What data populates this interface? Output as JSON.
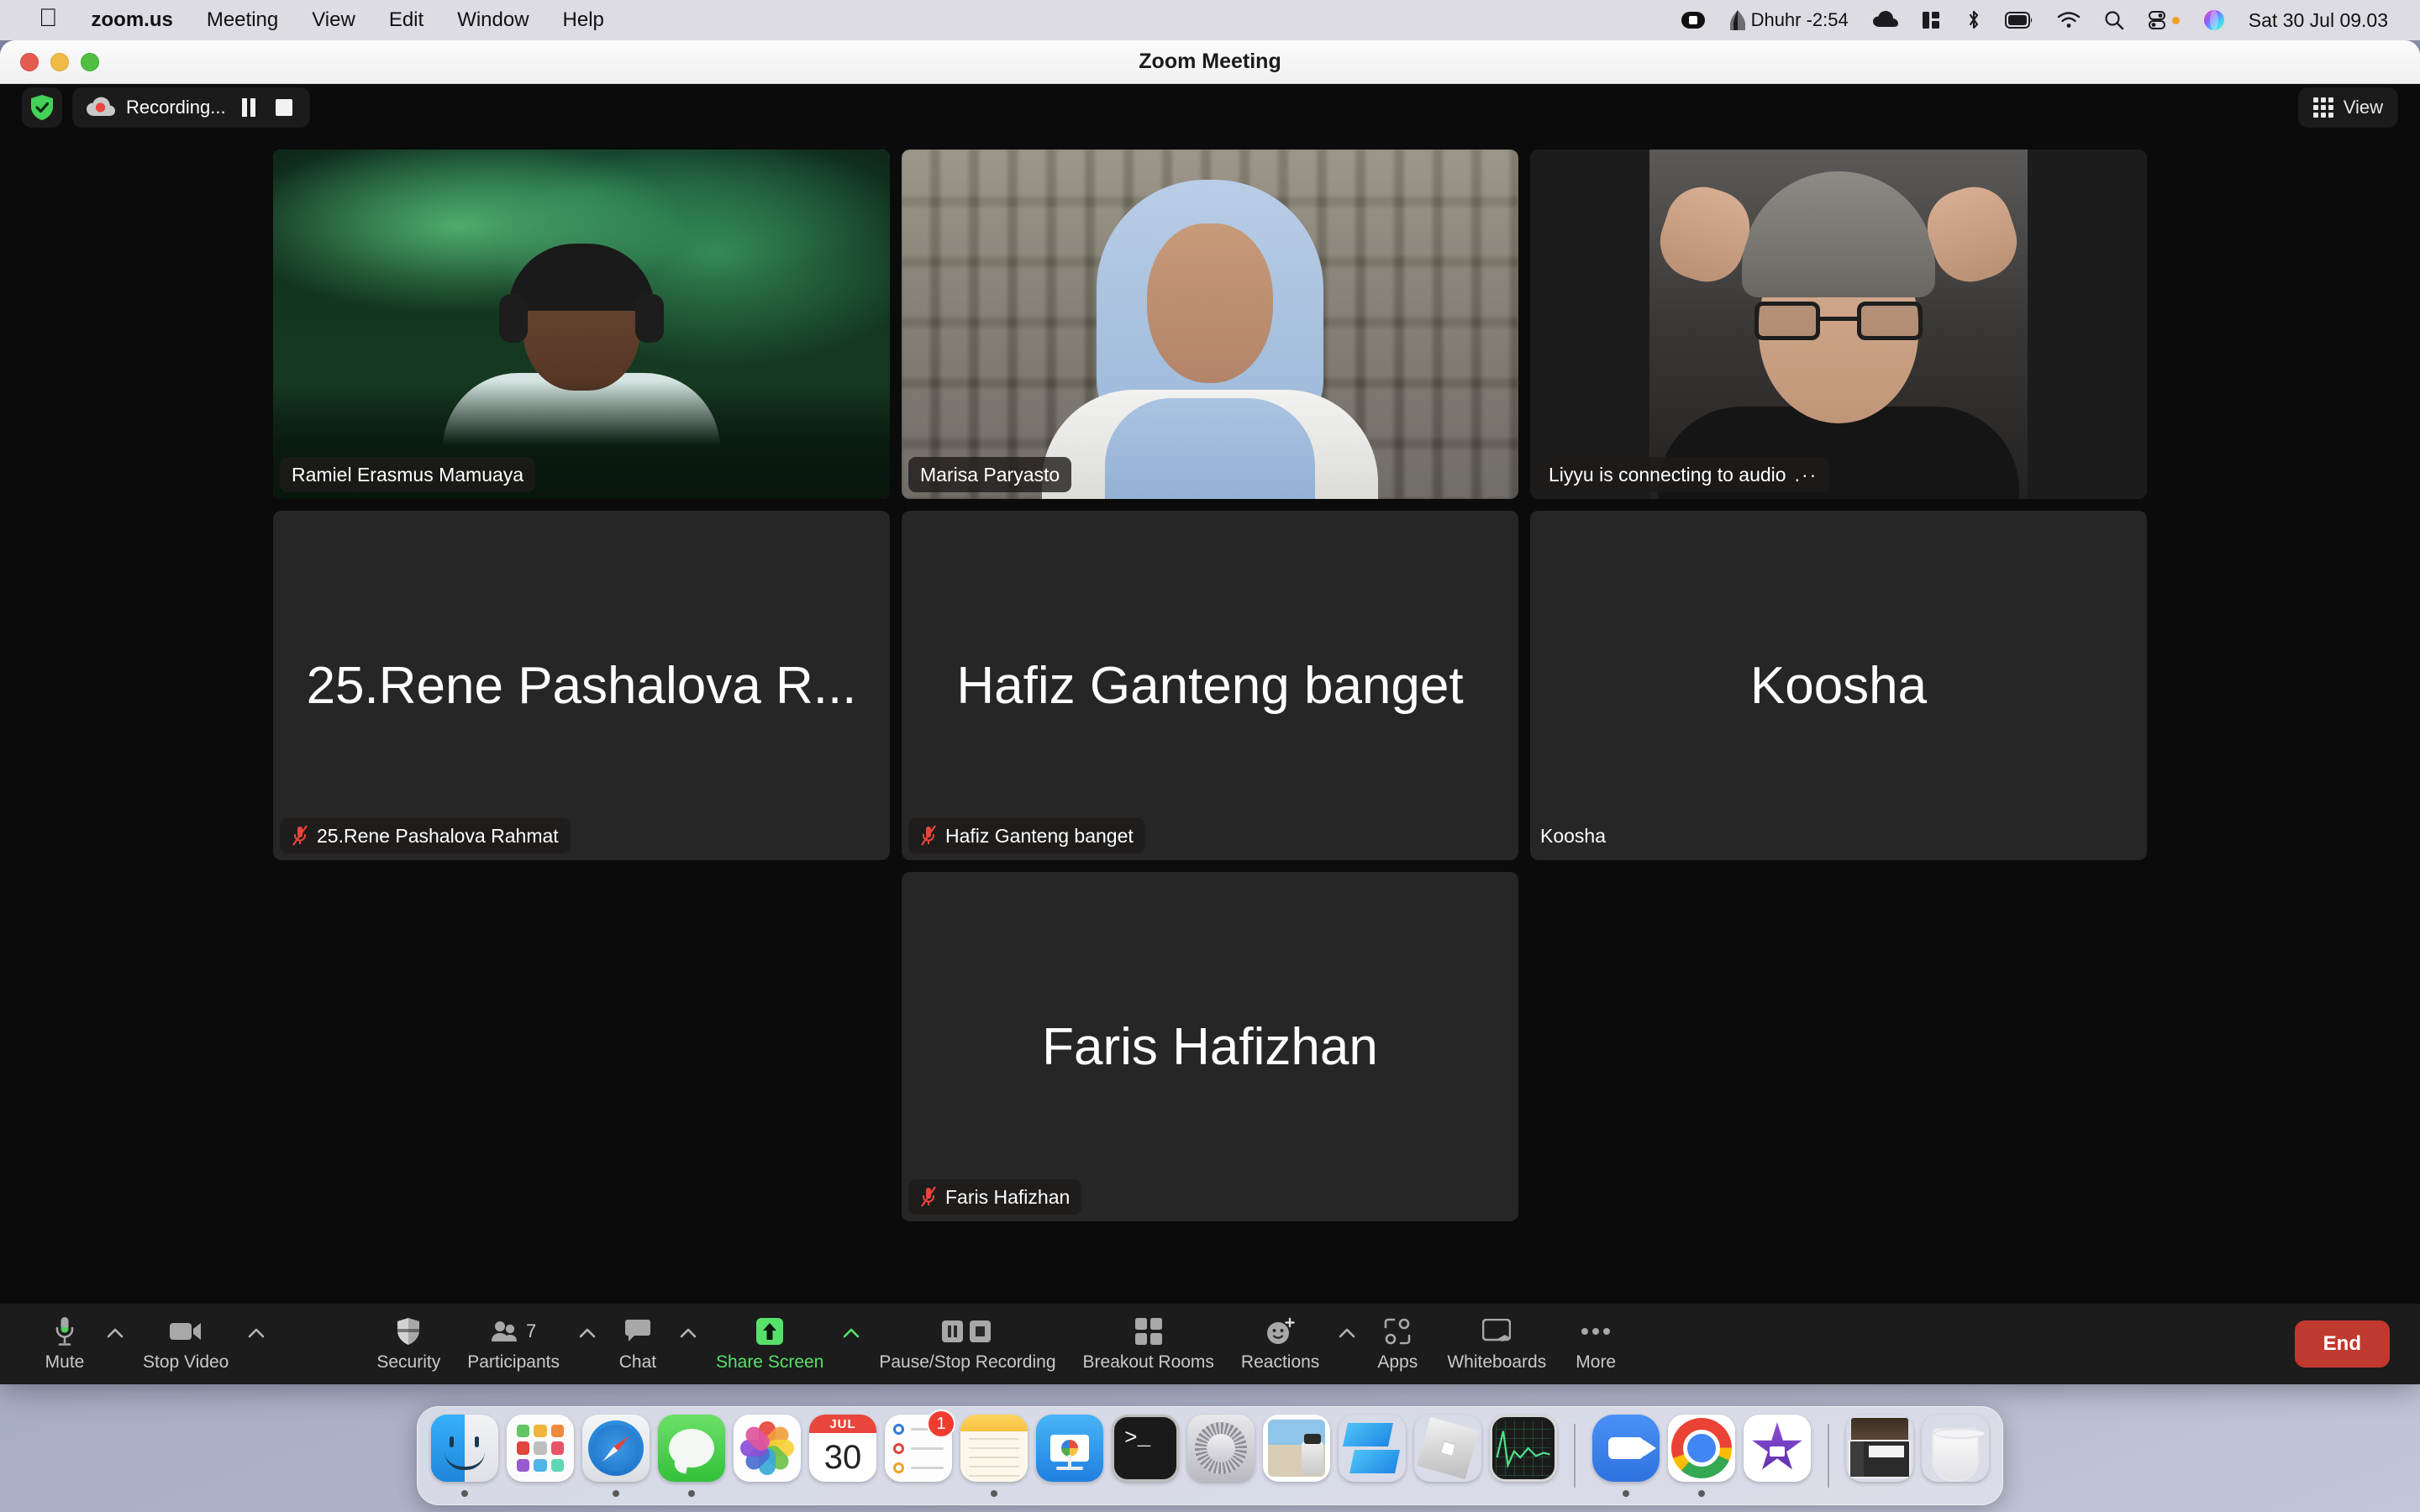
{
  "menubar": {
    "apple_icon": "apple-logo-icon",
    "items": [
      {
        "label": "zoom.us",
        "bold": true
      },
      {
        "label": "Meeting",
        "bold": false
      },
      {
        "label": "View",
        "bold": false
      },
      {
        "label": "Edit",
        "bold": false
      },
      {
        "label": "Window",
        "bold": false
      },
      {
        "label": "Help",
        "bold": false
      }
    ],
    "status": {
      "screen_recording_icon": "video-camera-icon",
      "prayer_label": "Dhuhr -2:54",
      "prayer_icon": "mosque-dome-icon",
      "cloud_icon": "cloud-icon",
      "stage_manager_icon": "stage-manager-icon",
      "bluetooth_icon": "bluetooth-icon",
      "battery_icon": "battery-icon",
      "wifi_icon": "wifi-icon",
      "search_icon": "spotlight-search-icon",
      "controlcenter_icon": "control-center-icon",
      "siri_icon": "siri-icon",
      "datetime": "Sat 30 Jul  09.03"
    }
  },
  "window": {
    "title": "Zoom Meeting",
    "traffic_lights": [
      "close",
      "minimize",
      "zoom"
    ]
  },
  "topbar": {
    "shield_icon": "security-shield-check-icon",
    "recording_icon": "cloud-recording-icon",
    "recording_label": "Recording...",
    "pause_icon": "pause-icon",
    "stop_icon": "stop-icon",
    "view_icon": "grid-view-icon",
    "view_label": "View"
  },
  "participants_grid": {
    "rows": [
      [
        {
          "name": "Ramiel Erasmus Mamuaya",
          "display": "video",
          "speaking": true,
          "muted": false,
          "badge_style": "dark",
          "video_style": "aurora"
        },
        {
          "name": "Marisa Paryasto",
          "display": "video",
          "speaking": false,
          "muted": false,
          "badge_style": "dark",
          "video_style": "hijab"
        },
        {
          "name": "Liyyu is connecting to audio",
          "display": "video",
          "speaking": false,
          "muted": false,
          "badge_style": "dark",
          "video_style": "dark3",
          "suffix": ".··"
        }
      ],
      [
        {
          "name": "25.Rene Pashalova Rahmat",
          "big_text": "25.Rene Pashalova R...",
          "display": "name",
          "speaking": false,
          "muted": true,
          "badge_style": "dark"
        },
        {
          "name": "Hafiz Ganteng banget",
          "big_text": "Hafiz Ganteng banget",
          "display": "name",
          "speaking": false,
          "muted": true,
          "badge_style": "dark"
        },
        {
          "name": "Koosha",
          "big_text": "Koosha",
          "display": "name",
          "speaking": false,
          "muted": false,
          "badge_style": "plain"
        }
      ],
      [
        {
          "empty": true
        },
        {
          "name": "Faris Hafizhan",
          "big_text": "Faris Hafizhan",
          "display": "name",
          "speaking": false,
          "muted": true,
          "badge_style": "dark"
        },
        {
          "empty": true
        }
      ]
    ]
  },
  "controlbar": {
    "left": [
      {
        "label": "Mute",
        "icon": "microphone-icon",
        "caret": true,
        "highlight": false
      },
      {
        "label": "Stop Video",
        "icon": "video-camera-icon",
        "caret": true,
        "highlight": false
      }
    ],
    "center": [
      {
        "label": "Security",
        "icon": "shield-icon",
        "caret": false,
        "highlight": false
      },
      {
        "label": "Participants",
        "icon": "people-icon",
        "caret": true,
        "highlight": false,
        "count": "7"
      },
      {
        "label": "Chat",
        "icon": "chat-bubble-icon",
        "caret": true,
        "highlight": false
      },
      {
        "label": "Share Screen",
        "icon": "share-screen-up-arrow-icon",
        "caret": true,
        "highlight": true
      },
      {
        "label": "Pause/Stop Recording",
        "icon": "pause-stop-recording-icon",
        "caret": false,
        "highlight": false
      },
      {
        "label": "Breakout Rooms",
        "icon": "breakout-rooms-grid-icon",
        "caret": false,
        "highlight": false
      },
      {
        "label": "Reactions",
        "icon": "reactions-smiley-icon",
        "caret": true,
        "highlight": false
      },
      {
        "label": "Apps",
        "icon": "apps-icon",
        "caret": false,
        "highlight": false
      },
      {
        "label": "Whiteboards",
        "icon": "whiteboard-icon",
        "caret": false,
        "highlight": false
      },
      {
        "label": "More",
        "icon": "more-ellipsis-icon",
        "caret": false,
        "highlight": false
      }
    ],
    "end_label": "End",
    "end_color": "#c0392f"
  },
  "dock": {
    "items": [
      {
        "name": "Finder",
        "icon": "finder-icon",
        "running": true
      },
      {
        "name": "Launchpad",
        "icon": "launchpad-icon",
        "running": false
      },
      {
        "name": "Safari",
        "icon": "safari-icon",
        "running": true
      },
      {
        "name": "Messages",
        "icon": "messages-icon",
        "running": true
      },
      {
        "name": "Photos",
        "icon": "photos-icon",
        "running": false
      },
      {
        "name": "Calendar",
        "icon": "calendar-icon",
        "running": false,
        "month": "JUL",
        "day": "30"
      },
      {
        "name": "Reminders",
        "icon": "reminders-icon",
        "running": false,
        "badge": "1"
      },
      {
        "name": "Notes",
        "icon": "notes-icon",
        "running": true
      },
      {
        "name": "Keynote",
        "icon": "keynote-icon",
        "running": false
      },
      {
        "name": "Terminal",
        "icon": "terminal-icon",
        "running": false
      },
      {
        "name": "System Preferences",
        "icon": "system-preferences-icon",
        "running": false
      },
      {
        "name": "Preview",
        "icon": "preview-icon",
        "running": false
      },
      {
        "name": "Slack",
        "icon": "slack-icon",
        "running": false
      },
      {
        "name": "Roblox",
        "icon": "roblox-icon",
        "running": false
      },
      {
        "name": "Activity Monitor",
        "icon": "activity-monitor-icon",
        "running": false
      },
      {
        "separator": true
      },
      {
        "name": "Zoom",
        "icon": "zoom-app-icon",
        "running": true
      },
      {
        "name": "Google Chrome",
        "icon": "chrome-icon",
        "running": true
      },
      {
        "name": "iMovie",
        "icon": "imovie-icon",
        "running": false
      },
      {
        "separator": true
      },
      {
        "name": "Downloads",
        "icon": "downloads-stack-icon",
        "running": false
      },
      {
        "name": "Trash",
        "icon": "trash-icon",
        "running": false
      }
    ]
  }
}
